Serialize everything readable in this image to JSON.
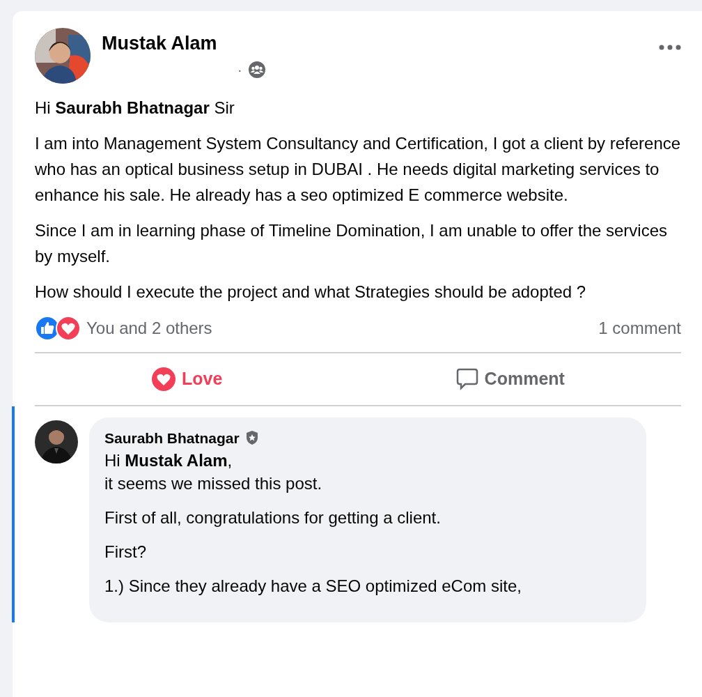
{
  "post": {
    "author": "Mustak Alam",
    "separator": "·",
    "paragraphs": [
      "Hi **Saurabh Bhatnagar** Sir",
      "I am into Management System Consultancy and Certification, I got a client by reference who has an optical business setup in DUBAI . He needs digital marketing services to enhance his sale. He already has a seo optimized E commerce website.",
      "Since I am in learning phase of Timeline Domination, I am unable to offer the services by myself.",
      "How should I execute the project and what Strategies should be adopted ?"
    ],
    "reaction_summary": "You and 2 others",
    "comment_count": "1 comment",
    "actions": [
      {
        "kind": "love",
        "label": "Love",
        "active": true
      },
      {
        "kind": "comment",
        "label": "Comment",
        "active": false
      }
    ]
  },
  "comment": {
    "author": "Saurabh Bhatnagar",
    "paragraphs": [
      "Hi **Mustak Alam**,\nit seems we missed this post.",
      "First of all, congratulations for getting a client.",
      "First?",
      "1.) Since they already have a SEO optimized eCom site,"
    ]
  }
}
